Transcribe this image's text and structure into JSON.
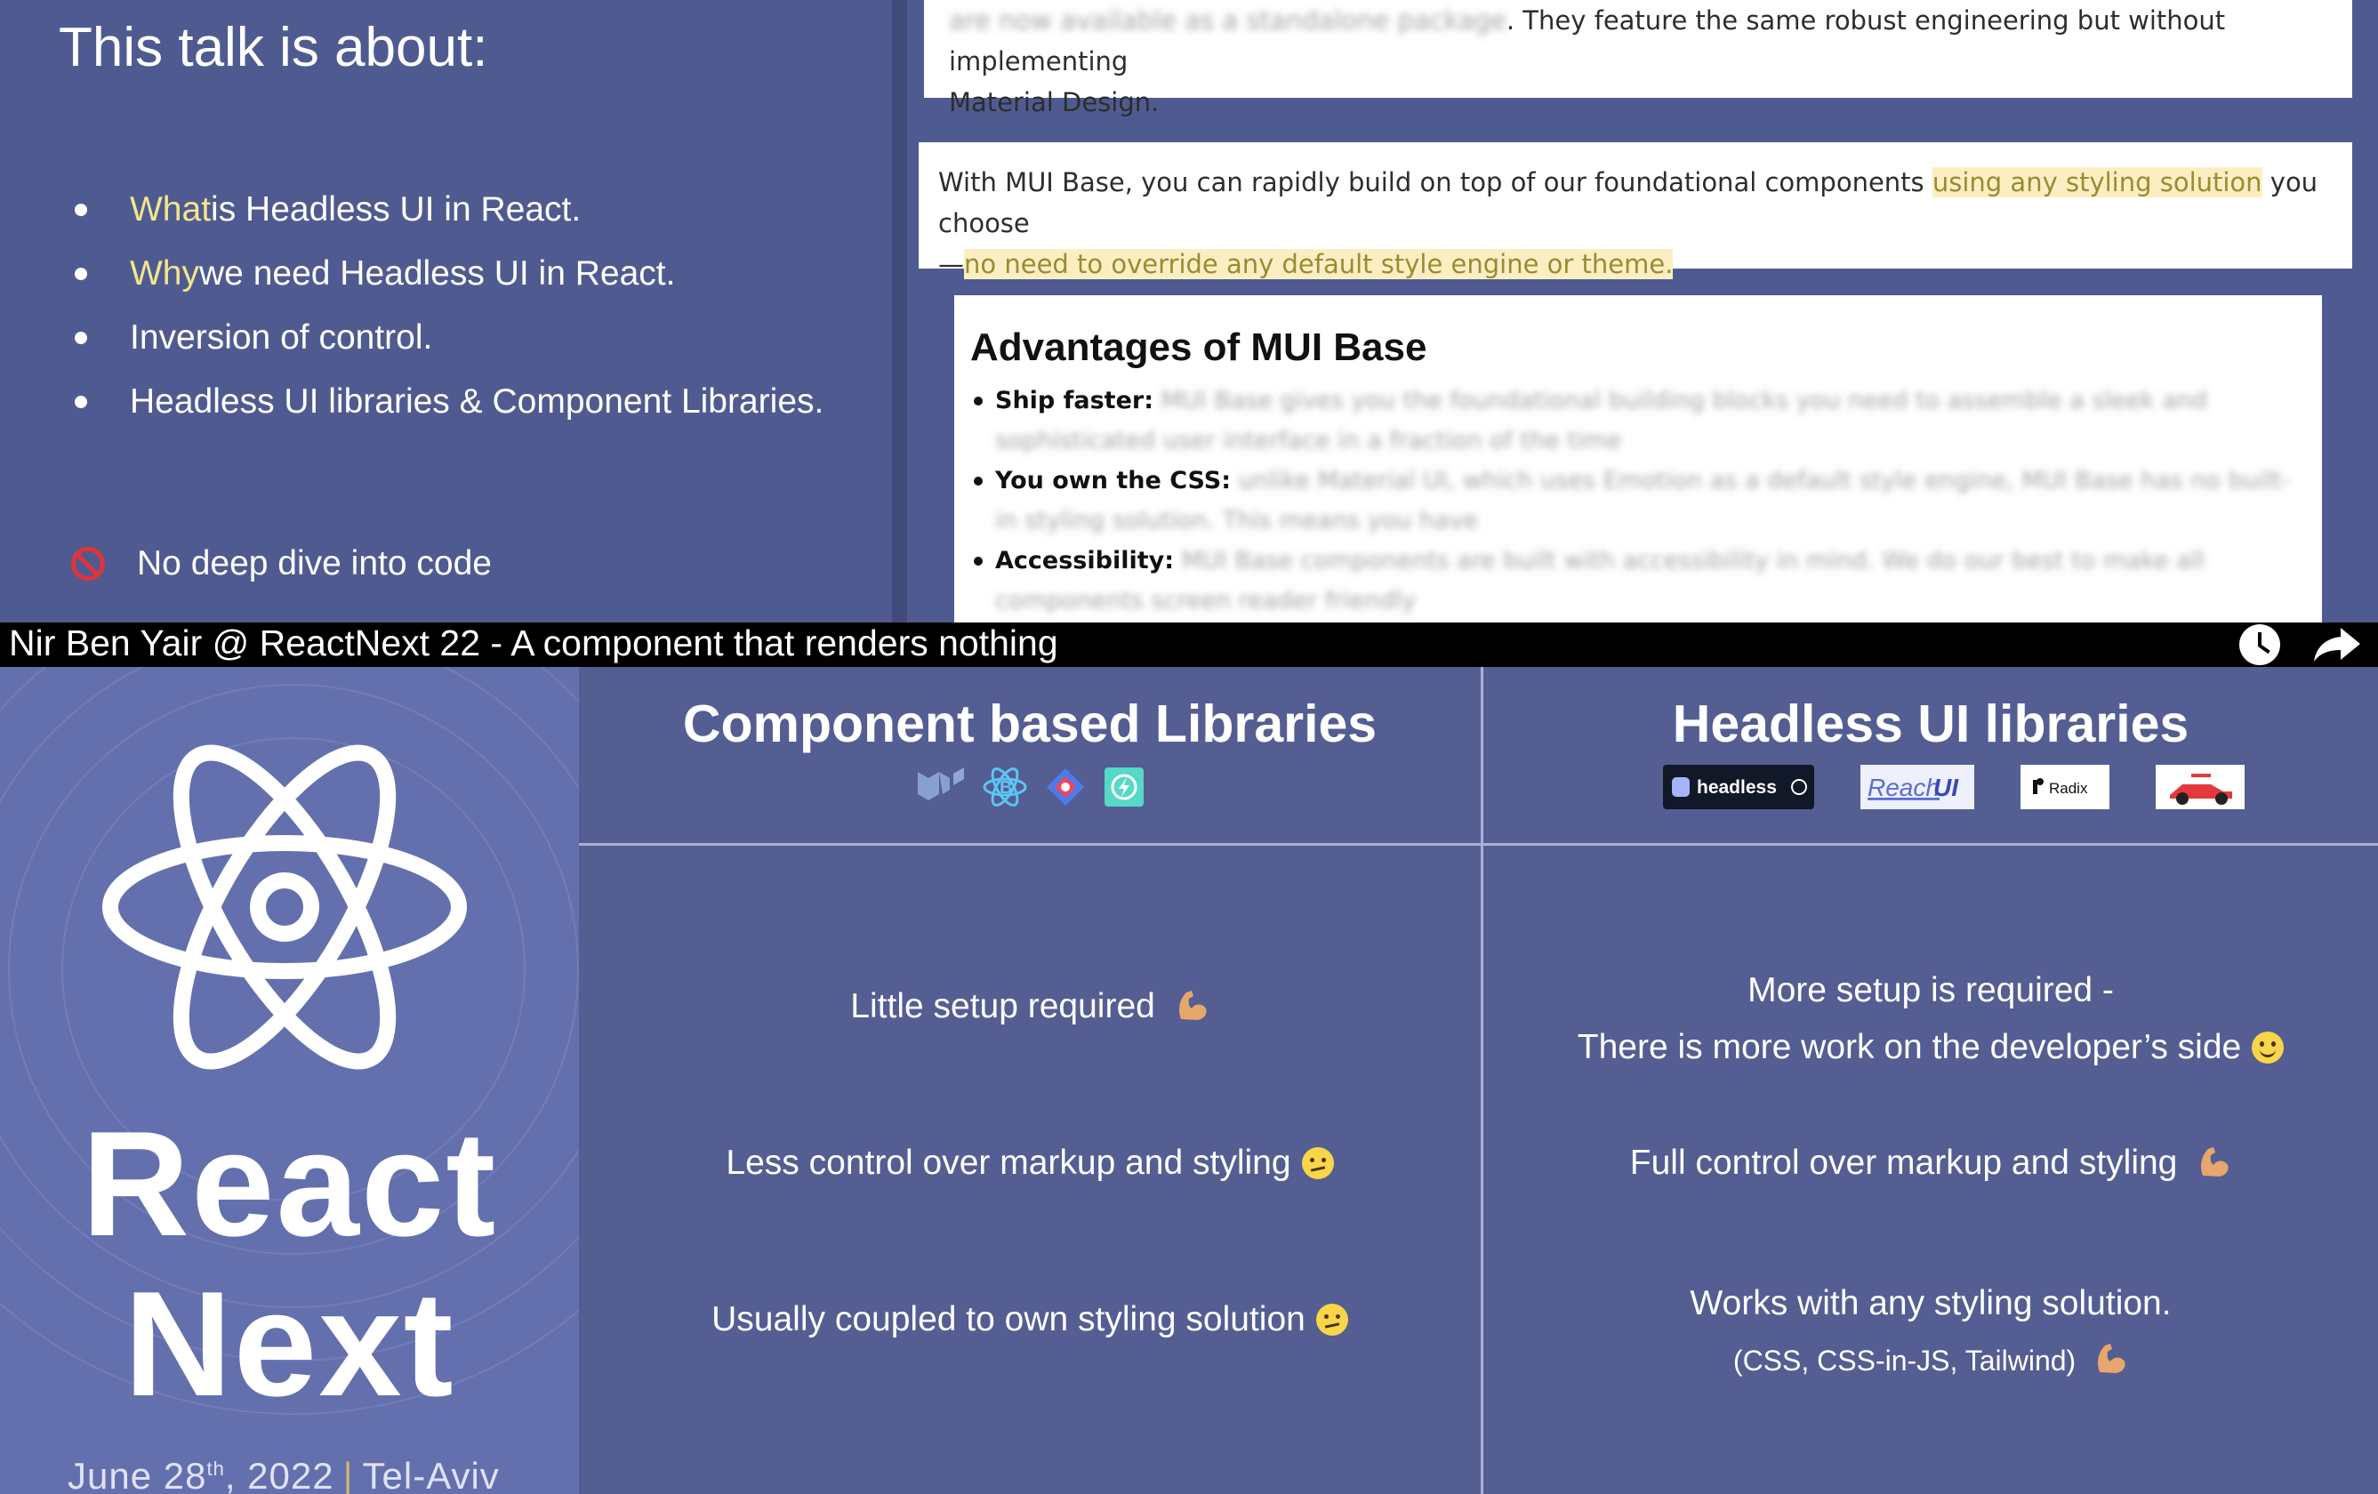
{
  "slide_left": {
    "title": "This talk is about:",
    "bullets": [
      {
        "highlight": "What",
        "rest": " is Headless UI in React."
      },
      {
        "highlight": "Why",
        "rest": " we need Headless UI in React."
      },
      {
        "highlight": "",
        "rest": "Inversion of control."
      },
      {
        "highlight": "",
        "rest": "Headless UI libraries & Component Libraries."
      }
    ],
    "no_dive": "No deep dive into code",
    "prohibit_icon": "prohibited-icon"
  },
  "docs": {
    "card1_line1_visible": ". They feature the same robust engineering but without implementing",
    "card1_line2": "Material Design.",
    "card2_pre": "With MUI Base, you can rapidly build on top of our foundational components ",
    "card2_hl1": "using any styling solution",
    "card2_mid": " you choose",
    "card2_dash": "—",
    "card2_hl2": "no need to override any default style engine or theme.",
    "card3_title": "Advantages of MUI Base",
    "advantages": [
      {
        "label": "Ship faster:"
      },
      {
        "label": "You own the CSS:"
      },
      {
        "label": "Accessibility:"
      }
    ]
  },
  "titlebar": {
    "title": "Nir Ben Yair @ ReactNext 22 - A component that renders nothing",
    "watch_later_icon": "clock-icon",
    "share_icon": "share-icon"
  },
  "brand": {
    "line1": "React",
    "line2": "Next",
    "date_pre": "June 28",
    "date_sup": "th",
    "date_post": ", 2022",
    "separator": "|",
    "city": "Tel-Aviv",
    "logo_icon": "react-atom-icon"
  },
  "columns": {
    "left_title": "Component based Libraries",
    "right_title": "Headless UI libraries",
    "left_logos": [
      "mui-logo-icon",
      "react-bootstrap-logo-icon",
      "ant-design-logo-icon",
      "chakra-logo-icon"
    ],
    "right_logos": {
      "headless": "headless",
      "reach": "Reach",
      "reach_ui": "UI",
      "radix": "Radix"
    }
  },
  "rows": {
    "l1": "Little setup required",
    "l2": "Less control over markup and styling",
    "l3": "Usually coupled to own styling solution",
    "r1a": "More setup is required -",
    "r1b": "There is more work on the developer’s side",
    "r2": "Full control over markup and styling",
    "r3a": "Works with any styling solution.",
    "r3b": "(CSS, CSS-in-JS, Tailwind)"
  },
  "colors": {
    "slide_bg": "#4f5b90",
    "brand_bg": "#6470ad",
    "highlight_text": "#f3e58c",
    "doc_highlight_bg": "#fbefc2"
  }
}
